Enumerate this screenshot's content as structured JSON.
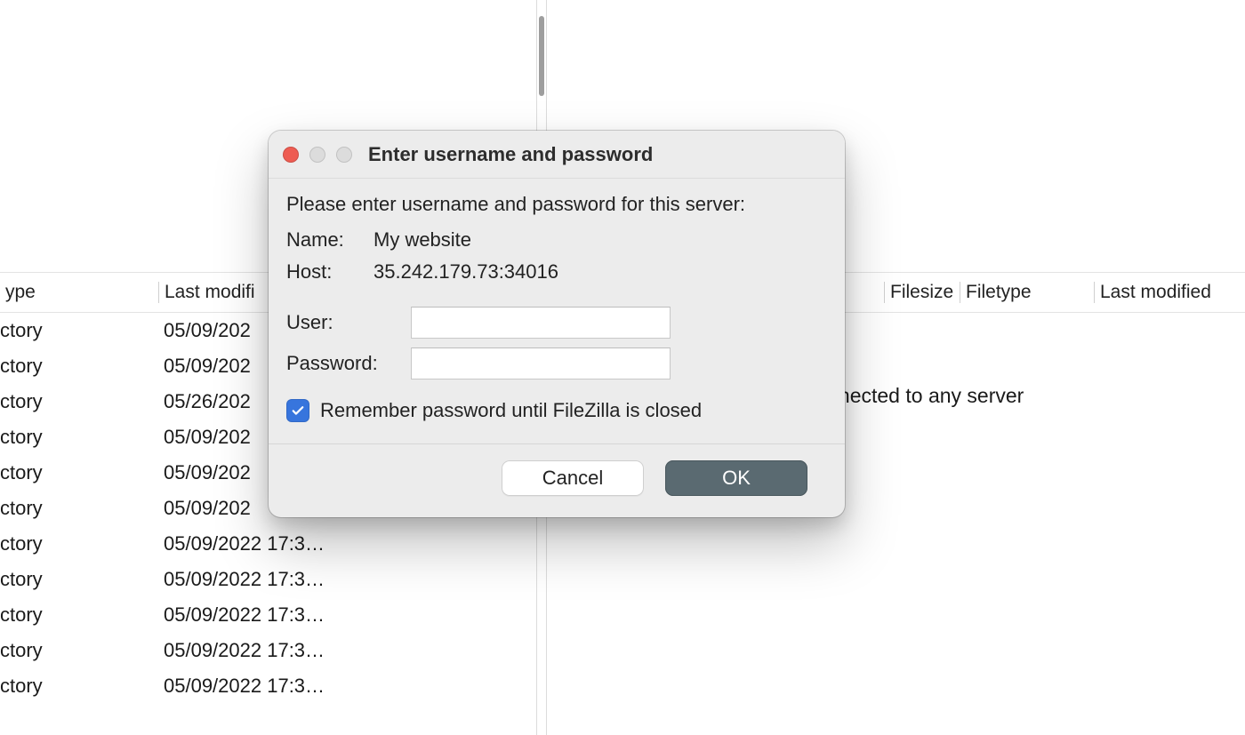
{
  "columns": {
    "left_type": "ype",
    "left_modified": "Last modifi",
    "right_filesize": "Filesize",
    "right_filetype": "Filetype",
    "right_modified": "Last modified"
  },
  "left_list": [
    {
      "type": "ctory",
      "modified": "05/09/202"
    },
    {
      "type": "ctory",
      "modified": "05/09/202"
    },
    {
      "type": "ctory",
      "modified": "05/26/202"
    },
    {
      "type": "ctory",
      "modified": "05/09/202"
    },
    {
      "type": "ctory",
      "modified": "05/09/202"
    },
    {
      "type": "ctory",
      "modified": "05/09/202"
    },
    {
      "type": "ctory",
      "modified": "05/09/2022 17:3…"
    },
    {
      "type": "ctory",
      "modified": "05/09/2022 17:3…"
    },
    {
      "type": "ctory",
      "modified": "05/09/2022 17:3…"
    },
    {
      "type": "ctory",
      "modified": "05/09/2022 17:3…"
    },
    {
      "type": "ctory",
      "modified": "05/09/2022 17:3…"
    }
  ],
  "right_list": {
    "empty_message": "Not connected to any server"
  },
  "dialog": {
    "title": "Enter username and password",
    "prompt": "Please enter username and password for this server:",
    "name_label": "Name:",
    "name_value": "My website",
    "host_label": "Host:",
    "host_value": "35.242.179.73:34016",
    "user_label": "User:",
    "user_value": "",
    "password_label": "Password:",
    "password_value": "",
    "remember_label": "Remember password until FileZilla is closed",
    "remember_checked": true,
    "cancel_label": "Cancel",
    "ok_label": "OK"
  }
}
